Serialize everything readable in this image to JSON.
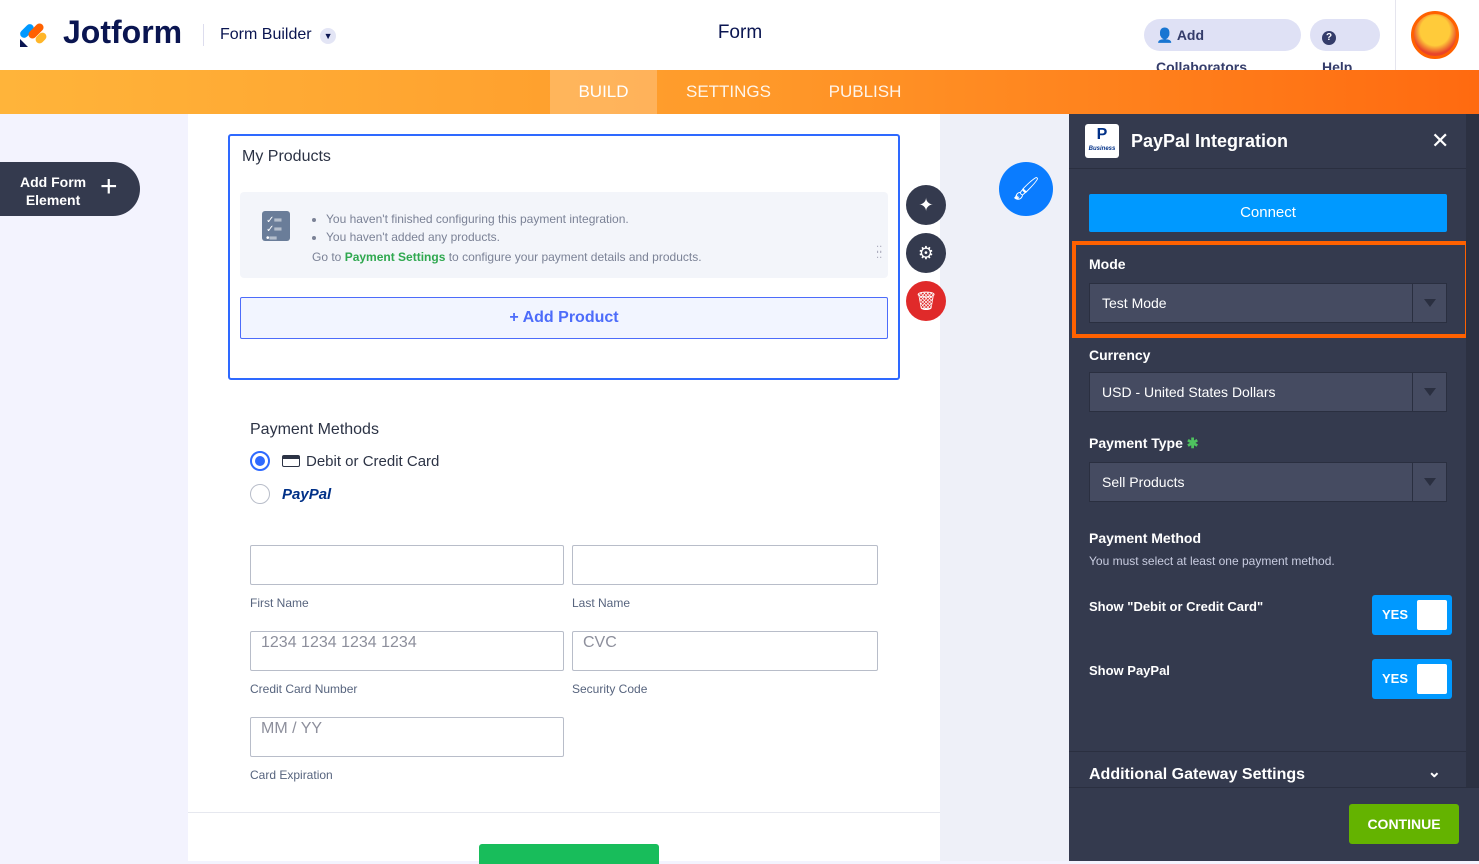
{
  "header": {
    "logo": "Jotform",
    "builder_label": "Form Builder",
    "form_title": "Form",
    "add_collaborators": "Add Collaborators",
    "help": "Help"
  },
  "tabs": [
    {
      "label": "BUILD",
      "active": true
    },
    {
      "label": "SETTINGS"
    },
    {
      "label": "PUBLISH"
    }
  ],
  "left": {
    "add_element_line1": "Add Form",
    "add_element_line2": "Element"
  },
  "form": {
    "products_title": "My Products",
    "warnings": [
      "You haven't finished configuring this payment integration.",
      "You haven't added any products."
    ],
    "goto_prefix": "Go to ",
    "goto_link": "Payment Settings",
    "goto_suffix": " to configure your payment details and products.",
    "add_product": "+ Add Product",
    "payment_methods_label": "Payment Methods",
    "methods": [
      {
        "label": "Debit or Credit Card",
        "selected": true
      },
      {
        "label": "PayPal",
        "selected": false
      }
    ],
    "first_name": "First Name",
    "last_name": "Last Name",
    "cc_placeholder": "1234 1234 1234 1234",
    "cc_label": "Credit Card Number",
    "cvc_placeholder": "CVC",
    "cvc_label": "Security Code",
    "exp_placeholder": "MM / YY",
    "exp_label": "Card Expiration"
  },
  "panel": {
    "title": "PayPal Integration",
    "logo_text": "Business",
    "connect": "Connect",
    "mode_label": "Mode",
    "mode_value": "Test Mode",
    "currency_label": "Currency",
    "currency_value": "USD - United States Dollars",
    "payment_type_label": "Payment Type",
    "payment_type_value": "Sell Products",
    "payment_method_label": "Payment Method",
    "payment_method_hint": "You must select at least one payment method.",
    "show_card_label": "Show \"Debit or Credit Card\"",
    "show_card_value": "YES",
    "show_paypal_label": "Show PayPal",
    "show_paypal_value": "YES",
    "additional": "Additional Gateway Settings",
    "continue": "CONTINUE"
  },
  "colors": {
    "accent": "#0099ff",
    "highlight": "#ff6100",
    "continue": "#64b300",
    "panel": "#343a4e"
  }
}
